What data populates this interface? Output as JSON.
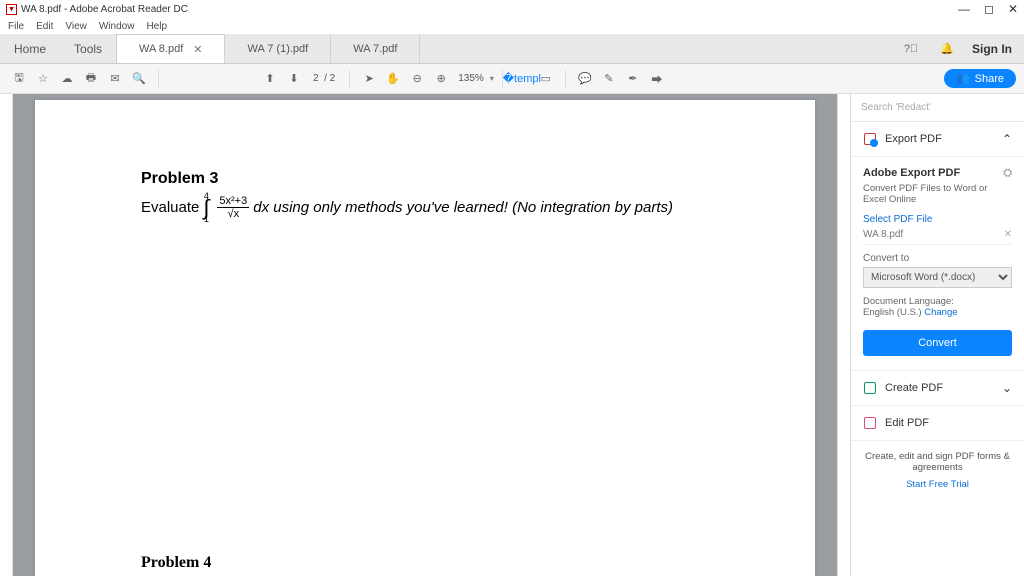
{
  "window": {
    "title": "WA 8.pdf - Adobe Acrobat Reader DC"
  },
  "menu": [
    "File",
    "Edit",
    "View",
    "Window",
    "Help"
  ],
  "tabs": {
    "home": "Home",
    "tools": "Tools",
    "docs": [
      {
        "label": "WA 8.pdf",
        "active": true,
        "closable": true
      },
      {
        "label": "WA 7 (1).pdf",
        "active": false
      },
      {
        "label": "WA 7.pdf",
        "active": false
      }
    ],
    "signin": "Sign In"
  },
  "toolbar": {
    "page_current": "2",
    "page_sep": "/ 2",
    "zoom": "135%",
    "share": "Share"
  },
  "document": {
    "p3_title": "Problem 3",
    "p3_pre": "Evaluate ",
    "p3_upper": "4",
    "p3_lower": "1",
    "p3_num": "5x²+3",
    "p3_den": "√x",
    "p3_post": " dx using only methods you've learned! (No integration by parts)",
    "p4_title": "Problem 4"
  },
  "sidebar": {
    "search_placeholder": "Search 'Redact'",
    "export_hd": "Export PDF",
    "export_title": "Adobe Export PDF",
    "export_sub": "Convert PDF Files to Word or Excel Online",
    "select_label": "Select PDF File",
    "file_name": "WA 8.pdf",
    "convert_to_label": "Convert to",
    "convert_to_value": "Microsoft Word (*.docx)",
    "lang_label": "Document Language:",
    "lang_value": "English (U.S.) ",
    "lang_change": "Change",
    "convert_btn": "Convert",
    "create_pdf": "Create PDF",
    "edit_pdf": "Edit PDF",
    "promo_text": "Create, edit and sign PDF forms & agreements",
    "promo_link": "Start Free Trial"
  }
}
